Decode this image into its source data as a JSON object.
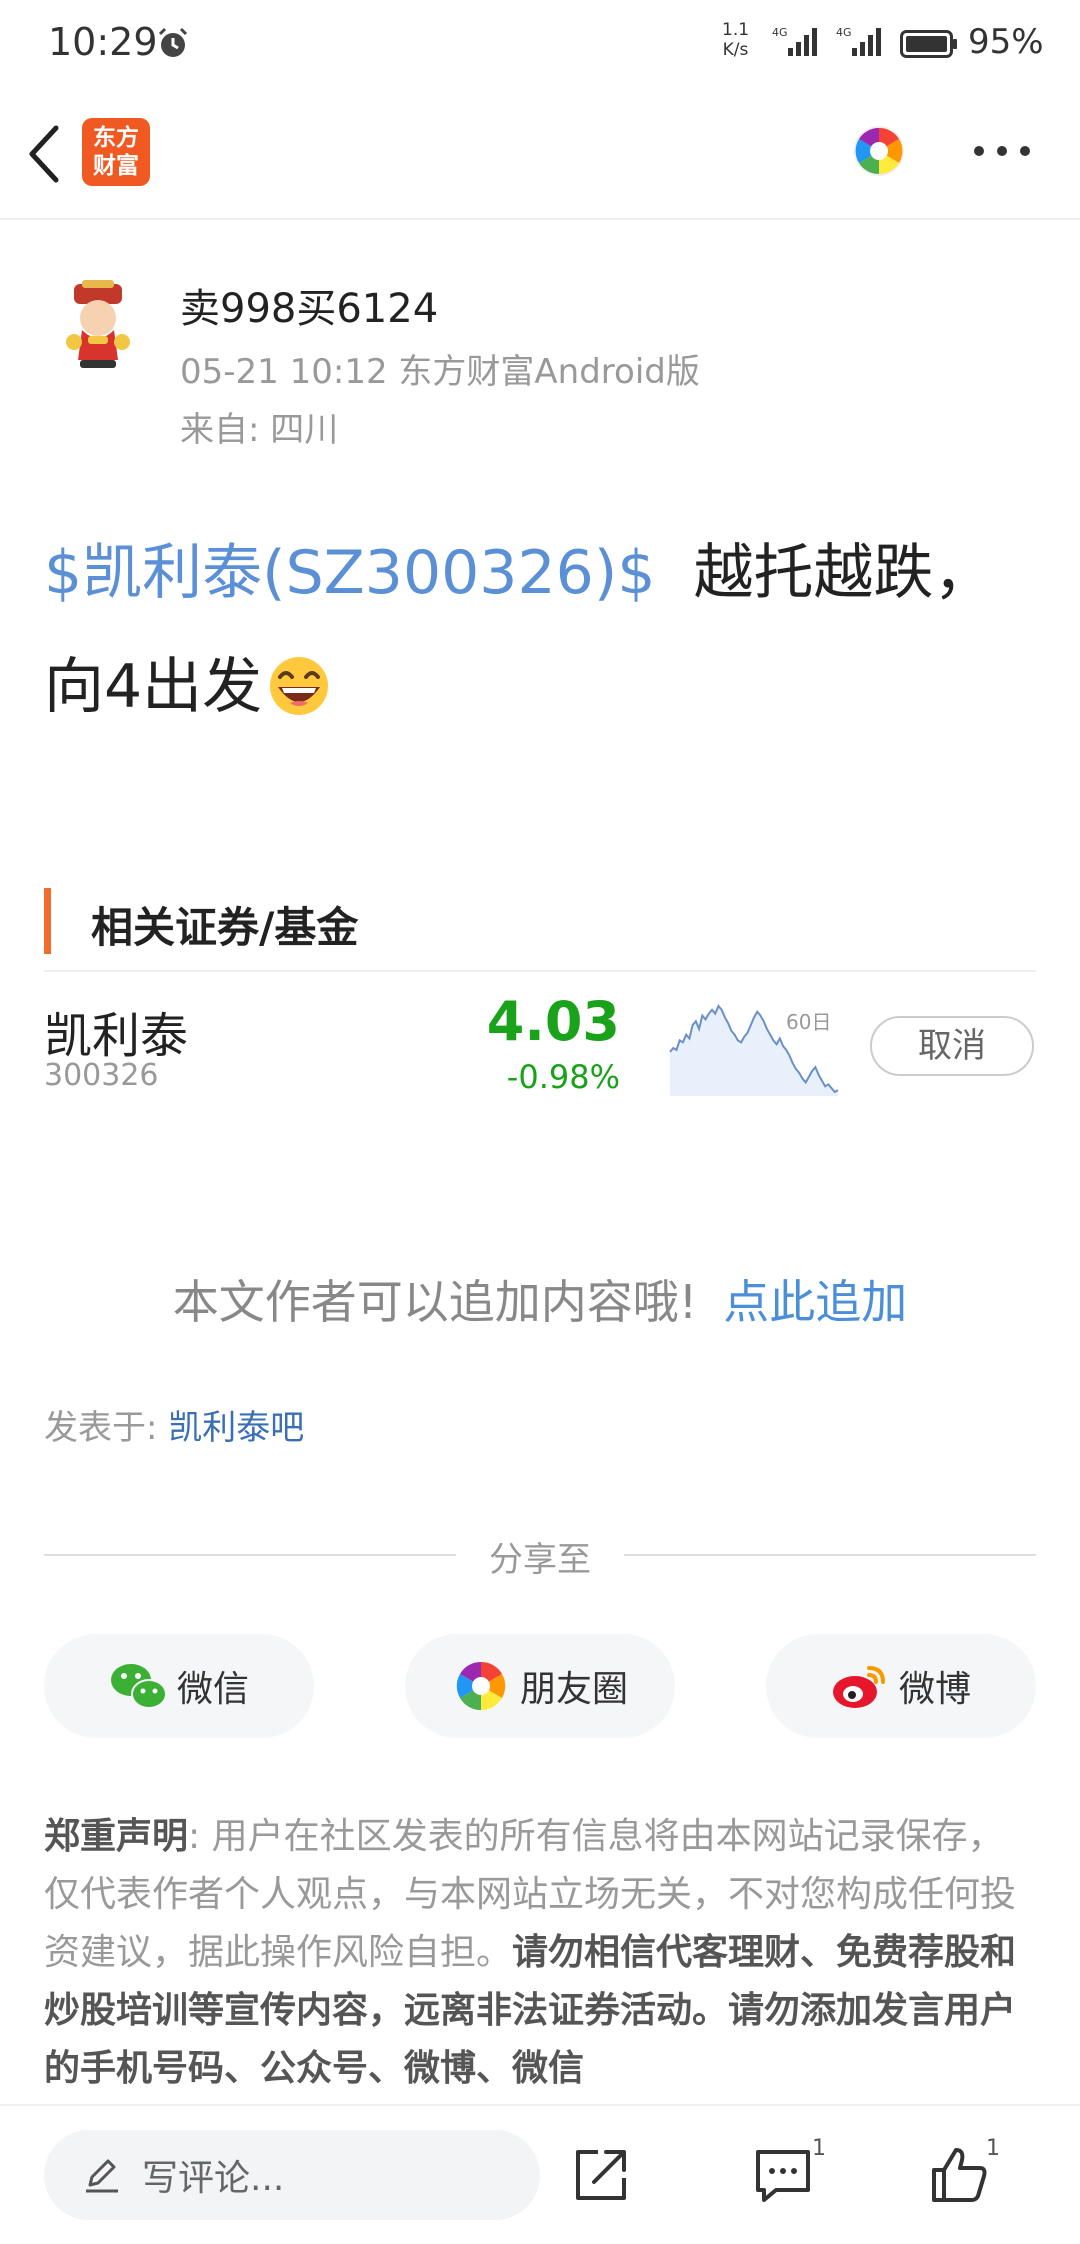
{
  "status_bar": {
    "time": "10:29",
    "net_speed_top": "1.1",
    "net_speed_bottom": "K/s",
    "signal1_label": "4G",
    "signal2_label": "4G",
    "battery": "95%"
  },
  "nav": {
    "logo_line1": "东方",
    "logo_line2": "财富",
    "brand_color": "#f05a22"
  },
  "post": {
    "author": "卖998买6124",
    "meta": "05-21 10:12 东方财富Android版",
    "location": "来自: 四川",
    "stock_tag": "$凯利泰(SZ300326)$",
    "text_part1": "越托越跌，",
    "text_part2": "向4出发",
    "emoji": "laughing-emoji"
  },
  "related": {
    "title": "相关证券/基金",
    "stock_name": "凯利泰",
    "stock_code": "300326",
    "price": "4.03",
    "change": "-0.98%",
    "sparkline_label": "60日",
    "sparkline_values": [
      58,
      54,
      56,
      46,
      48,
      40,
      44,
      30,
      26,
      34,
      20,
      24,
      18,
      14,
      18,
      10,
      14,
      22,
      28,
      36,
      40,
      46,
      48,
      42,
      38,
      30,
      22,
      16,
      20,
      26,
      34,
      40,
      46,
      50,
      44,
      52,
      56,
      62,
      70,
      76,
      80,
      86,
      90,
      84,
      78,
      74,
      82,
      88,
      94,
      92,
      96,
      100,
      98
    ],
    "cancel_label": "取消",
    "down_color": "#1aa31a",
    "accent_color": "#f06c2d"
  },
  "append": {
    "text": "本文作者可以追加内容哦!",
    "link": "点此追加"
  },
  "posted_in": {
    "label": "发表于: ",
    "bar": "凯利泰吧"
  },
  "share": {
    "label": "分享至",
    "wechat": "微信",
    "moments": "朋友圈",
    "weibo": "微博"
  },
  "disclaimer": {
    "title": "郑重声明",
    "body1": ": 用户在社区发表的所有信息将由本网站记录保存，仅代表作者个人观点，与本网站立场无关，不对您构成任何投资建议，据此操作风险自担。",
    "body2": "请勿相信代客理财、免费荐股和炒股培训等宣传内容，远离非法证券活动。请勿添加发言用户的手机号码、公众号、微博、微信"
  },
  "bottom_bar": {
    "comment_placeholder": "写评论...",
    "comment_count": "1",
    "like_count": "1"
  }
}
